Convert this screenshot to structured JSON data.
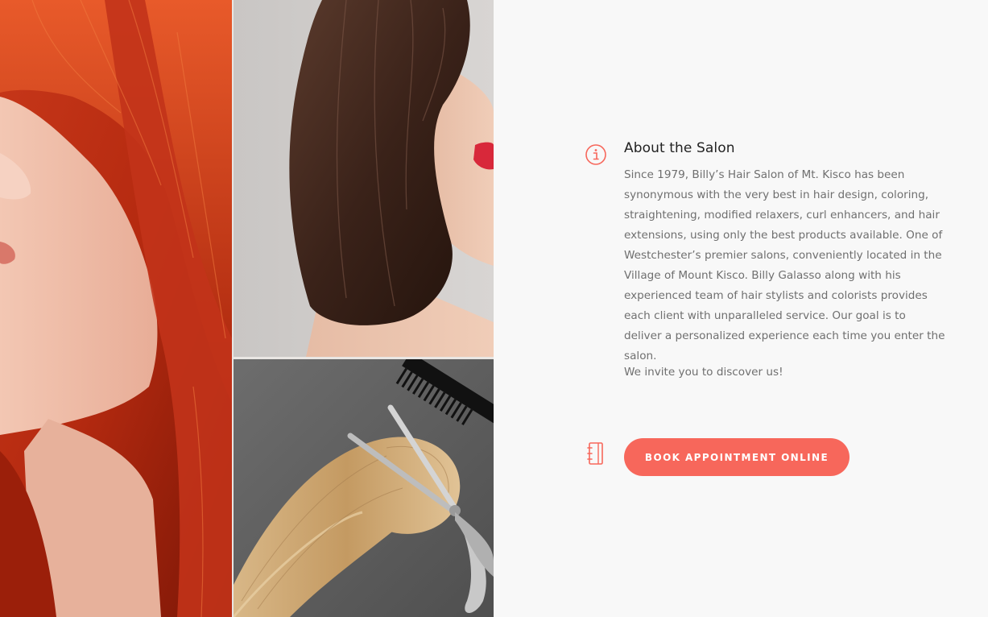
{
  "collage": {
    "images": [
      {
        "name": "red-hair-woman-photo"
      },
      {
        "name": "brunette-bob-woman-photo"
      },
      {
        "name": "scissors-comb-blonde-hair-photo"
      }
    ]
  },
  "about": {
    "icon": "info-circle-icon",
    "title": "About the Salon",
    "body": "Since 1979, Billy’s Hair Salon of Mt. Kisco has been synonymous with the very best in hair design, coloring, straightening, modified relaxers, curl enhancers, and hair extensions, using only the best products available. One of Westchester’s premier salons, conveniently located in the Village of Mount Kisco. Billy Galasso along with his experienced team of hair stylists and colorists provides each client with unparalleled service. Our goal is to deliver a personalized experience each time you enter the salon.",
    "invite": "We invite you to discover us!"
  },
  "booking": {
    "icon": "notebook-icon",
    "button_label": "BOOK APPOINTMENT ONLINE"
  },
  "colors": {
    "accent": "#f7675b",
    "background": "#f8f8f8",
    "title_text": "#222222",
    "body_text": "#6f6f6f"
  }
}
